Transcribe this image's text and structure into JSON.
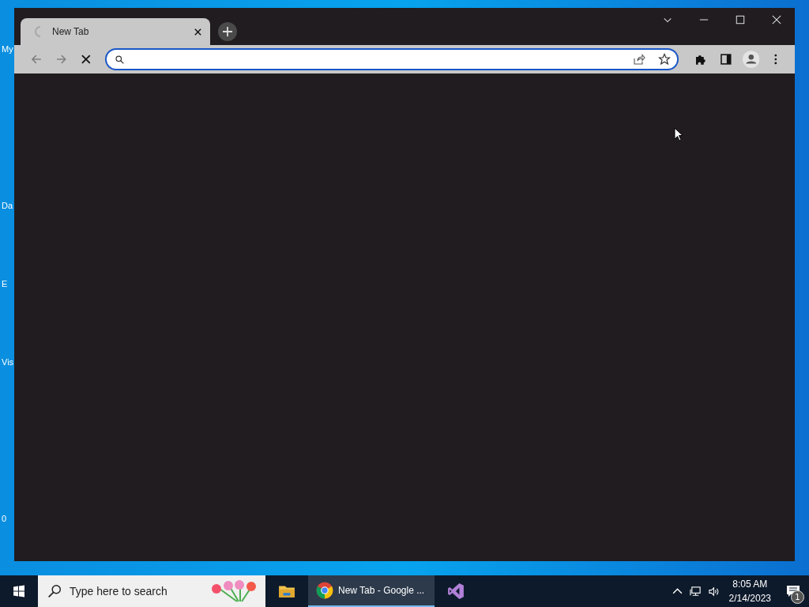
{
  "desktop": {
    "icon_labels": [
      "My",
      "Da",
      "E",
      "Vis",
      "0"
    ]
  },
  "browser": {
    "tabs": [
      {
        "title": "New Tab",
        "selected": true,
        "loading": true
      }
    ],
    "loading": true
  },
  "taskbar": {
    "search": {
      "placeholder": "Type here to search"
    },
    "apps": [
      {
        "kind": "explorer",
        "selected": false
      },
      {
        "kind": "chrome",
        "label": "New Tab - Google ...",
        "selected": true
      },
      {
        "kind": "visualstudio",
        "selected": false
      }
    ],
    "clock": {
      "time": "8:05 AM",
      "date": "2/14/2023"
    },
    "notifications": {
      "count": "1"
    }
  }
}
